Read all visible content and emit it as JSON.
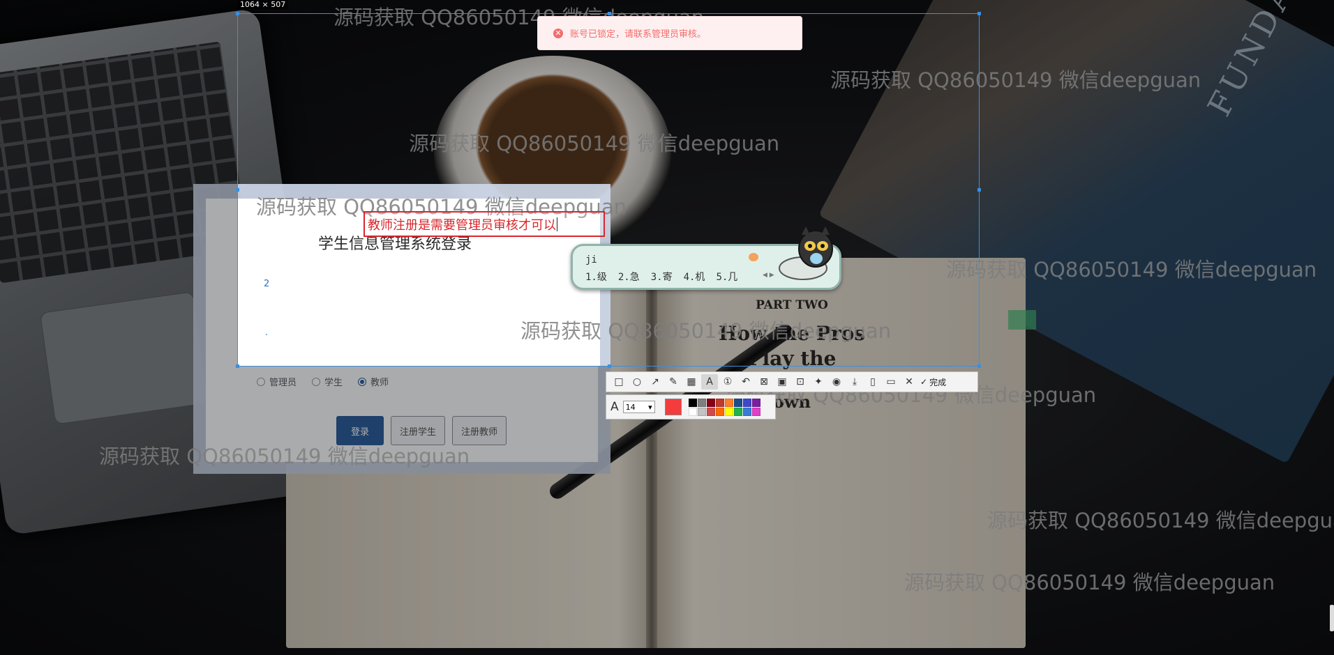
{
  "selection": {
    "size_label": "1064 × 507"
  },
  "toast": {
    "message": "账号已锁定，请联系管理员审核。",
    "color": "#f56c6c"
  },
  "login": {
    "title": "学生信息管理系统登录",
    "marker_digit": "2",
    "marker_dot": ".",
    "roles": [
      {
        "label": "管理员",
        "checked": false
      },
      {
        "label": "学生",
        "checked": false
      },
      {
        "label": "教师",
        "checked": true
      }
    ],
    "buttons": {
      "login": "登录",
      "register_student": "注册学生",
      "register_teacher": "注册教师"
    },
    "accent": "#2f5f9e"
  },
  "annotation": {
    "text": "教师注册是需要管理员审核才可以",
    "color": "#d9262b"
  },
  "ime": {
    "input": "ji",
    "candidates": [
      "1.级",
      "2.急",
      "3.寄",
      "4.机",
      "5.几"
    ]
  },
  "toolbar": {
    "tools": [
      "rectangle-icon",
      "ellipse-icon",
      "arrow-icon",
      "pen-icon",
      "mosaic-icon",
      "text-icon",
      "number-icon",
      "undo-icon",
      "crop-icon",
      "image-icon",
      "scan-icon",
      "pin-icon",
      "record-icon",
      "download-icon",
      "copy-icon",
      "save-icon",
      "close-icon"
    ],
    "active_tool": "text-icon",
    "done_label": "完成",
    "font_size": "14",
    "current_color": "#f53c3c",
    "palette": [
      "#000000",
      "#7f7f7f",
      "#880015",
      "#c0392b",
      "#ff7f27",
      "#1d4e89",
      "#3f48cc",
      "#7a1fa2",
      "#ffffff",
      "#c3c3c3",
      "#b97a57",
      "#e84c3d",
      "#ffcc00",
      "#22b14c",
      "#3d8bd9",
      "#a349a4"
    ],
    "palette_row2": [
      "#ffffff",
      "#c3c3c3",
      "#d04a4a",
      "#ff6a00",
      "#ffff00",
      "#22b14c",
      "#3a7bd5",
      "#e040c8"
    ]
  },
  "watermark": "源码获取 QQ86050149 微信deepguan",
  "book": {
    "part": "PART TWO",
    "line1": "How the Pros",
    "line2": "Play the",
    "line3": "own",
    "cover": "FUNDAMENTALS CORPORATE"
  }
}
